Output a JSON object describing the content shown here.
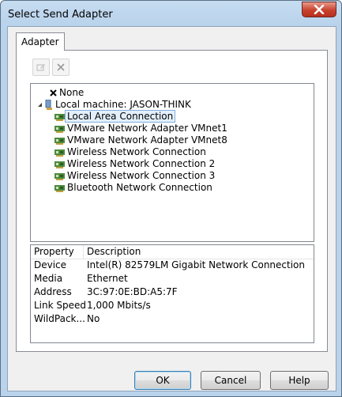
{
  "window": {
    "title": "Select Send Adapter",
    "close_icon": "close-icon"
  },
  "tabs": [
    {
      "label": "Adapter"
    }
  ],
  "toolbar": {
    "edit_icon": "edit-icon",
    "delete_icon": "delete-icon"
  },
  "tree": {
    "none_label": "None",
    "machine_label": "Local machine: JASON-THINK",
    "adapters": [
      "Local Area Connection",
      "VMware Network Adapter VMnet1",
      "VMware Network Adapter VMnet8",
      "Wireless Network Connection",
      "Wireless Network Connection 2",
      "Wireless Network Connection 3",
      "Bluetooth Network Connection"
    ],
    "selected": "Local Area Connection"
  },
  "properties": {
    "columns": [
      "Property",
      "Description"
    ],
    "rows": [
      [
        "Device",
        "Intel(R) 82579LM Gigabit Network Connection"
      ],
      [
        "Media",
        "Ethernet"
      ],
      [
        "Address",
        "3C:97:0E:BD:A5:7F"
      ],
      [
        "Link Speed",
        "1,000 Mbits/s"
      ],
      [
        "WildPack...",
        "No"
      ]
    ]
  },
  "buttons": {
    "ok": "OK",
    "cancel": "Cancel",
    "help": "Help"
  }
}
